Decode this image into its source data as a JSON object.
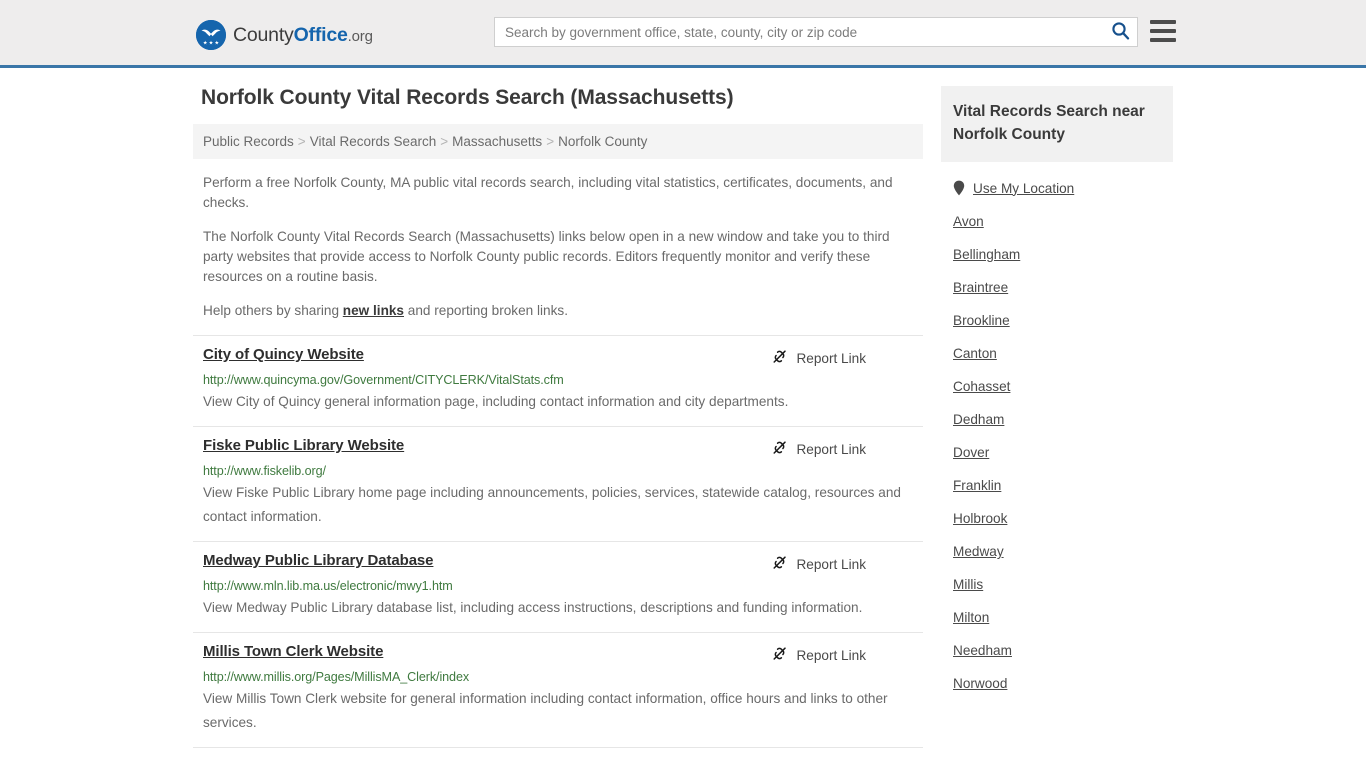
{
  "header": {
    "logo": {
      "icon": "eagle-shield-icon",
      "text_county": "County",
      "text_office": "Office",
      "text_org": ".org"
    },
    "search": {
      "placeholder": "Search by government office, state, county, city or zip code",
      "value": "",
      "icon": "search-icon"
    },
    "menu_icon": "hamburger-menu-icon"
  },
  "page": {
    "title": "Norfolk County Vital Records Search (Massachusetts)",
    "breadcrumb": {
      "separator": ">",
      "items": [
        "Public Records",
        "Vital Records Search",
        "Massachusetts",
        "Norfolk County"
      ]
    },
    "intro": {
      "p1": "Perform a free Norfolk County, MA public vital records search, including vital statistics, certificates, documents, and checks.",
      "p2": "The Norfolk County Vital Records Search (Massachusetts) links below open in a new window and take you to third party websites that provide access to Norfolk County public records. Editors frequently monitor and verify these resources on a routine basis.",
      "p3_before": "Help others by sharing ",
      "p3_link": "new links",
      "p3_after": " and reporting broken links."
    },
    "report_link_label": "Report Link",
    "report_link_icon": "broken-link-icon",
    "results": [
      {
        "title": "City of Quincy Website",
        "url": "http://www.quincyma.gov/Government/CITYCLERK/VitalStats.cfm",
        "description": "View City of Quincy general information page, including contact information and city departments."
      },
      {
        "title": "Fiske Public Library Website",
        "url": "http://www.fiskelib.org/",
        "description": "View Fiske Public Library home page including announcements, policies, services, statewide catalog, resources and contact information."
      },
      {
        "title": "Medway Public Library Database",
        "url": "http://www.mln.lib.ma.us/electronic/mwy1.htm",
        "description": "View Medway Public Library database list, including access instructions, descriptions and funding information."
      },
      {
        "title": "Millis Town Clerk Website",
        "url": "http://www.millis.org/Pages/MillisMA_Clerk/index",
        "description": "View Millis Town Clerk website for general information including contact information, office hours and links to other services."
      }
    ]
  },
  "sidebar": {
    "heading": "Vital Records Search near Norfolk County",
    "use_my_location": {
      "label": "Use My Location",
      "icon": "map-pin-icon"
    },
    "cities": [
      "Avon",
      "Bellingham",
      "Braintree",
      "Brookline",
      "Canton",
      "Cohasset",
      "Dedham",
      "Dover",
      "Franklin",
      "Holbrook",
      "Medway",
      "Millis",
      "Milton",
      "Needham",
      "Norwood"
    ]
  },
  "colors": {
    "header_bg": "#eeeded",
    "header_border": "#3a76a8",
    "brand_blue": "#1565ad",
    "url_green": "#3f7a3f",
    "breadcrumb_bg": "#f4f4f4",
    "sidebar_head_bg": "#f1f1f1"
  }
}
